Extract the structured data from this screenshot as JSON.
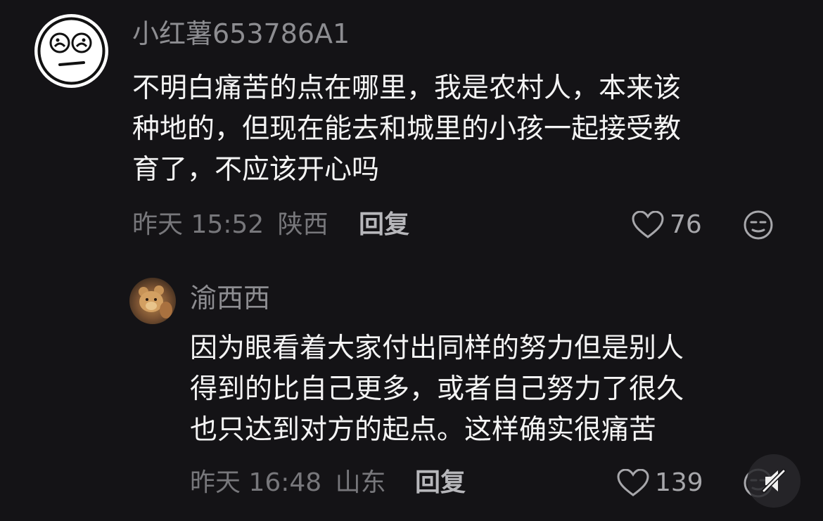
{
  "comment1": {
    "username": "小红薯653786A1",
    "lines": [
      "不明白痛苦的点在哪里，我是农村人，本来该",
      "种地的，但现在能去和城里的小孩一起接受教",
      "育了，不应该开心吗"
    ],
    "time": "昨天 15:52",
    "location": "陕西",
    "reply_label": "回复",
    "likes": "76",
    "avatar_icon": "sad-face-drawing",
    "like_icon": "heart-outline-icon",
    "react_icon": "expressionless-face-icon"
  },
  "comment2": {
    "username": "渝西西",
    "lines": [
      "因为眼看着大家付出同样的努力但是别人",
      "得到的比自己更多，或者自己努力了很久",
      "也只达到对方的起点。这样确实很痛苦"
    ],
    "time": "昨天 16:48",
    "location": "山东",
    "reply_label": "回复",
    "likes": "139",
    "avatar_icon": "teddy-bear-photo",
    "like_icon": "heart-outline-icon",
    "react_icon": "expressionless-face-icon"
  },
  "watermark_icon": "mute-speaker-icon",
  "colors": {
    "background": "#141316",
    "primary_text": "#f4f4f4",
    "secondary_text": "#8d8d91",
    "meta_text": "#77777b"
  }
}
